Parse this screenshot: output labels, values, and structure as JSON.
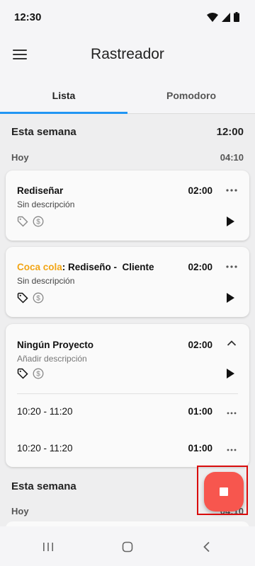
{
  "status_bar": {
    "time": "12:30"
  },
  "app_bar": {
    "title": "Rastreador"
  },
  "tabs": [
    {
      "label": "Lista"
    },
    {
      "label": "Pomodoro"
    }
  ],
  "week1": {
    "title": "Esta semana",
    "total": "12:00",
    "day": {
      "label": "Hoy",
      "total": "04:10"
    }
  },
  "entries": [
    {
      "title": "Rediseñar",
      "description": "Sin descripción",
      "duration": "02:00"
    },
    {
      "client": "Coca cola",
      "separator": ": ",
      "title": "Rediseño -  Cliente",
      "description": "Sin descripción",
      "duration": "02:00"
    },
    {
      "title": "Ningún Proyecto",
      "description": "Añadir descripción",
      "duration": "02:00",
      "sub_entries": [
        {
          "time": "10:20 - 11:20",
          "duration": "01:00"
        },
        {
          "time": "10:20 - 11:20",
          "duration": "01:00"
        }
      ]
    }
  ],
  "week2": {
    "title": "Esta semana",
    "day": {
      "label": "Hoy",
      "total": "04:10"
    }
  },
  "icons": {
    "menu": "menu-icon",
    "tag": "tag-icon",
    "billable": "dollar-icon",
    "more": "more-horizontal-icon",
    "play": "play-icon",
    "collapse": "chevron-up-icon",
    "stop": "stop-icon",
    "wifi": "wifi-icon",
    "signal": "signal-icon",
    "battery": "battery-icon"
  },
  "colors": {
    "accent": "#2196f3",
    "client": "#f2a515",
    "fab": "#f7564e"
  }
}
